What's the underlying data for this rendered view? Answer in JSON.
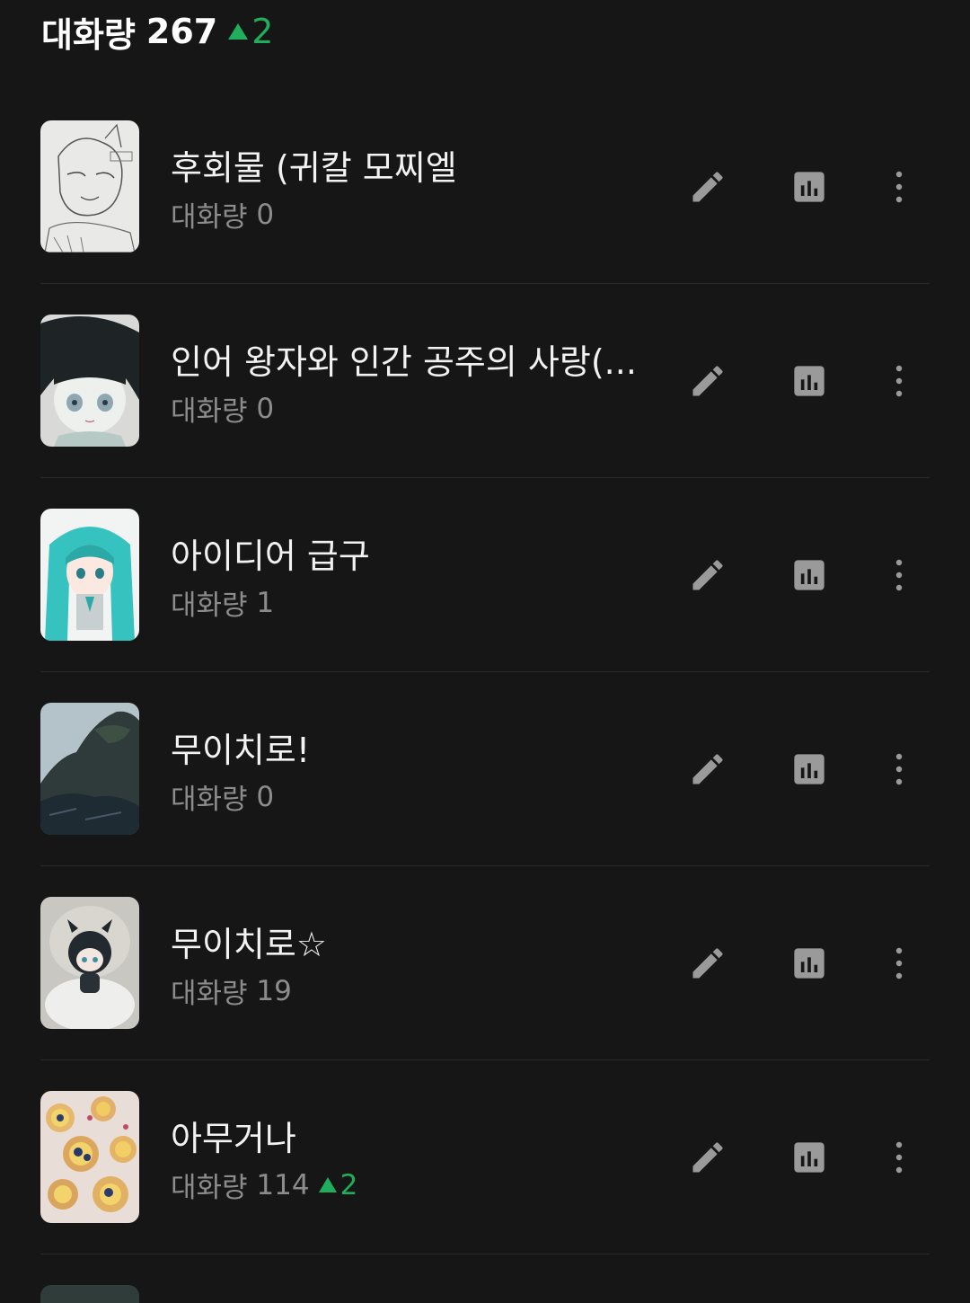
{
  "header": {
    "label": "대화량",
    "count": "267",
    "delta": "2"
  },
  "colors": {
    "background": "#161616",
    "accent_green": "#1fae5b",
    "subtext": "#8c8c8c",
    "icon": "#9a9a9a"
  },
  "icons": {
    "edit": "pencil-icon",
    "stats": "bar-chart-icon",
    "more": "more-vertical-icon"
  },
  "items": [
    {
      "title": "후회물 (귀칼 모찌엘",
      "sub_label": "대화량",
      "sub_count": "0",
      "delta": ""
    },
    {
      "title": "인어 왕자와 인간 공주의 사랑(...",
      "sub_label": "대화량",
      "sub_count": "0",
      "delta": ""
    },
    {
      "title": "아이디어 급구",
      "sub_label": "대화량",
      "sub_count": "1",
      "delta": ""
    },
    {
      "title": "무이치로!",
      "sub_label": "대화량",
      "sub_count": "0",
      "delta": ""
    },
    {
      "title": "무이치로☆",
      "sub_label": "대화량",
      "sub_count": "19",
      "delta": ""
    },
    {
      "title": "아무거나",
      "sub_label": "대화량",
      "sub_count": "114",
      "delta": "2"
    }
  ]
}
